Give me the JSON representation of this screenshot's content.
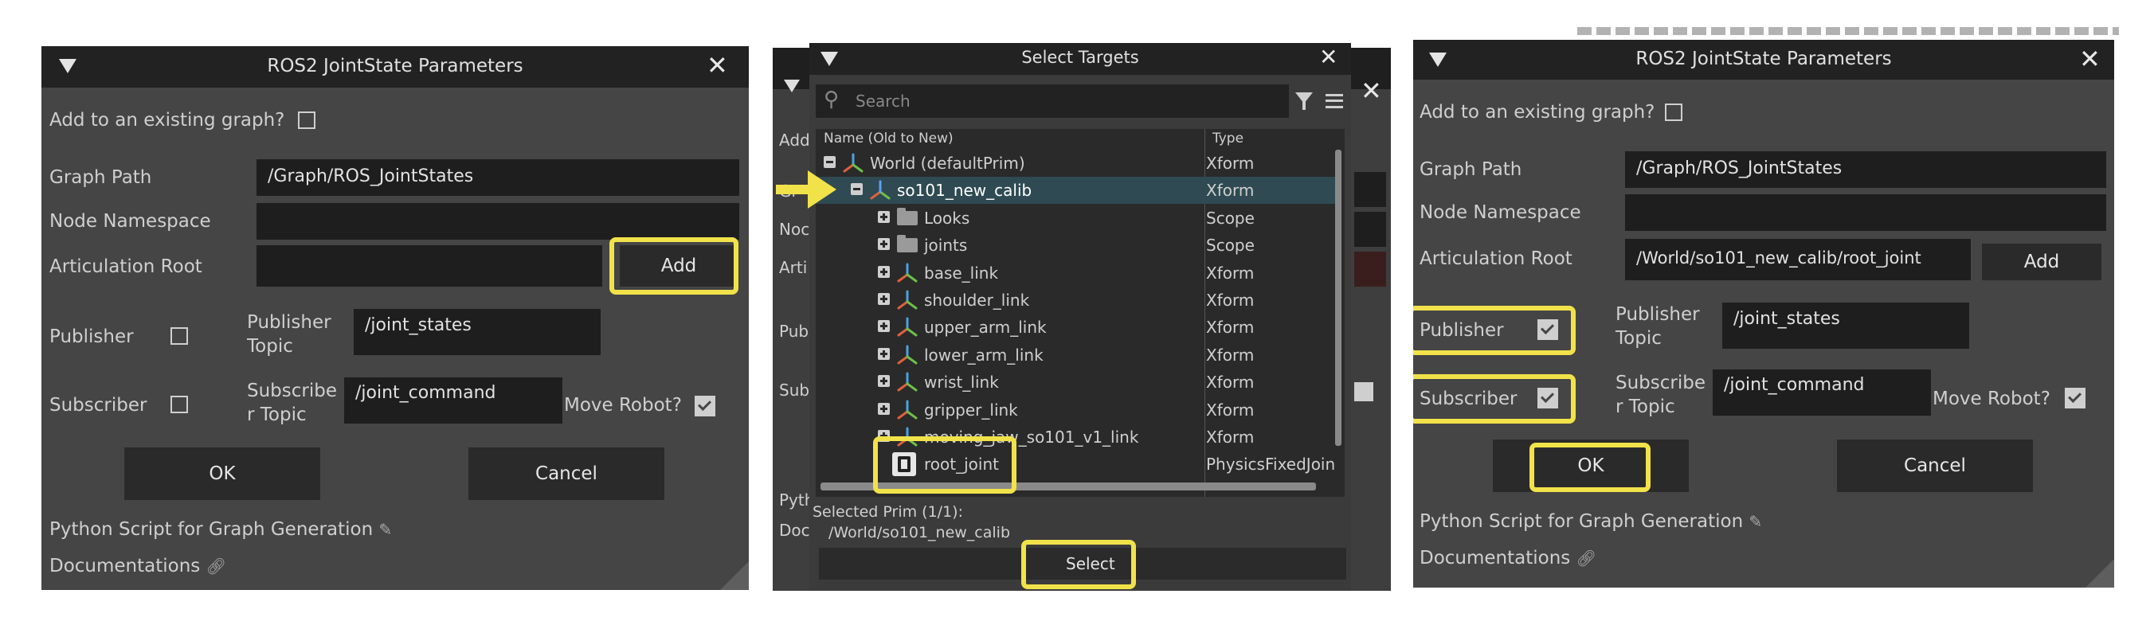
{
  "dialog1": {
    "title": "ROS2 JointState Parameters",
    "add_existing_label": "Add to an existing graph?",
    "graph_path_label": "Graph Path",
    "graph_path_value": "/Graph/ROS_JointStates",
    "node_namespace_label": "Node Namespace",
    "node_namespace_value": "",
    "articulation_root_label": "Articulation Root",
    "articulation_root_value": "",
    "add_button": "Add",
    "publisher_label": "Publisher",
    "publisher_topic_label_1": "Publisher",
    "publisher_topic_label_2": "Topic",
    "publisher_topic_value": "/joint_states",
    "subscriber_label": "Subscriber",
    "subscriber_topic_label_1": "Subscribe",
    "subscriber_topic_label_2": "r Topic",
    "subscriber_topic_value": "/joint_command",
    "move_robot_label": "Move Robot?",
    "ok_button": "OK",
    "cancel_button": "Cancel",
    "python_script_link": "Python Script for Graph Generation",
    "documentations_link": "Documentations"
  },
  "select_targets": {
    "title": "Select Targets",
    "search_placeholder": "Search",
    "col_name": "Name (Old to New)",
    "col_type": "Type",
    "rows": [
      {
        "name": "World (defaultPrim)",
        "type": "Xform",
        "icon": "xform-icon"
      },
      {
        "name": "so101_new_calib",
        "type": "Xform",
        "icon": "robot-xform-icon"
      },
      {
        "name": "Looks",
        "type": "Scope",
        "icon": "folder-icon"
      },
      {
        "name": "joints",
        "type": "Scope",
        "icon": "folder-icon"
      },
      {
        "name": "base_link",
        "type": "Xform",
        "icon": "xform-icon"
      },
      {
        "name": "shoulder_link",
        "type": "Xform",
        "icon": "xform-icon"
      },
      {
        "name": "upper_arm_link",
        "type": "Xform",
        "icon": "xform-icon"
      },
      {
        "name": "lower_arm_link",
        "type": "Xform",
        "icon": "xform-icon"
      },
      {
        "name": "wrist_link",
        "type": "Xform",
        "icon": "xform-icon"
      },
      {
        "name": "gripper_link",
        "type": "Xform",
        "icon": "xform-icon"
      },
      {
        "name": "moving_jaw_so101_v1_link",
        "type": "Xform",
        "icon": "xform-icon"
      },
      {
        "name": "root_joint",
        "type": "PhysicsFixedJoin",
        "icon": "joint-icon"
      }
    ],
    "selected_prim_label": "Selected Prim (1/1):",
    "selected_prim_path": "/World/so101_new_calib",
    "select_button": "Select",
    "bg_labels": [
      "Add",
      "Gr",
      "Noc",
      "Arti",
      "Pub",
      "Sub",
      "Pyth",
      "Doc"
    ]
  },
  "dialog2": {
    "title": "ROS2 JointState Parameters",
    "add_existing_label": "Add to an existing graph?",
    "graph_path_label": "Graph Path",
    "graph_path_value": "/Graph/ROS_JointStates",
    "node_namespace_label": "Node Namespace",
    "node_namespace_value": "",
    "articulation_root_label": "Articulation Root",
    "articulation_root_value": "/World/so101_new_calib/root_joint",
    "add_button": "Add",
    "publisher_label": "Publisher",
    "publisher_topic_label_1": "Publisher",
    "publisher_topic_label_2": "Topic",
    "publisher_topic_value": "/joint_states",
    "subscriber_label": "Subscriber",
    "subscriber_topic_label_1": "Subscribe",
    "subscriber_topic_label_2": "r Topic",
    "subscriber_topic_value": "/joint_command",
    "move_robot_label": "Move Robot?",
    "ok_button": "OK",
    "cancel_button": "Cancel",
    "python_script_link": "Python Script for Graph Generation",
    "documentations_link": "Documentations"
  },
  "colors": {
    "highlight": "#f2e24a",
    "panel": "#454545",
    "titlebar": "#222222",
    "field": "#1e1e1e",
    "selected_row": "#2f4a52"
  }
}
